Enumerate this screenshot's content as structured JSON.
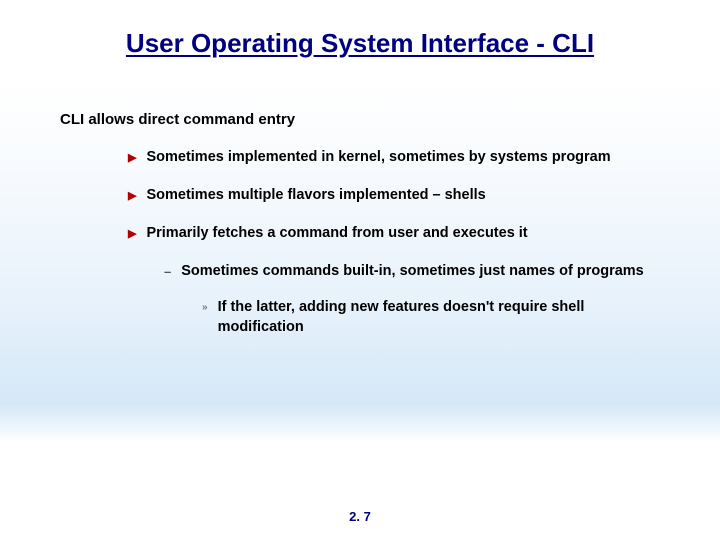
{
  "title": "User Operating System Interface - CLI",
  "lead": "CLI allows direct command entry",
  "bullets": {
    "b1": "Sometimes implemented in kernel, sometimes by systems program",
    "b2": "Sometimes multiple flavors implemented – shells",
    "b3": "Primarily fetches a command from user and executes it",
    "b3a": "Sometimes commands built-in, sometimes just names of programs",
    "b3a1": "If the latter, adding new features doesn't require shell modification"
  },
  "page_number": "2. 7"
}
